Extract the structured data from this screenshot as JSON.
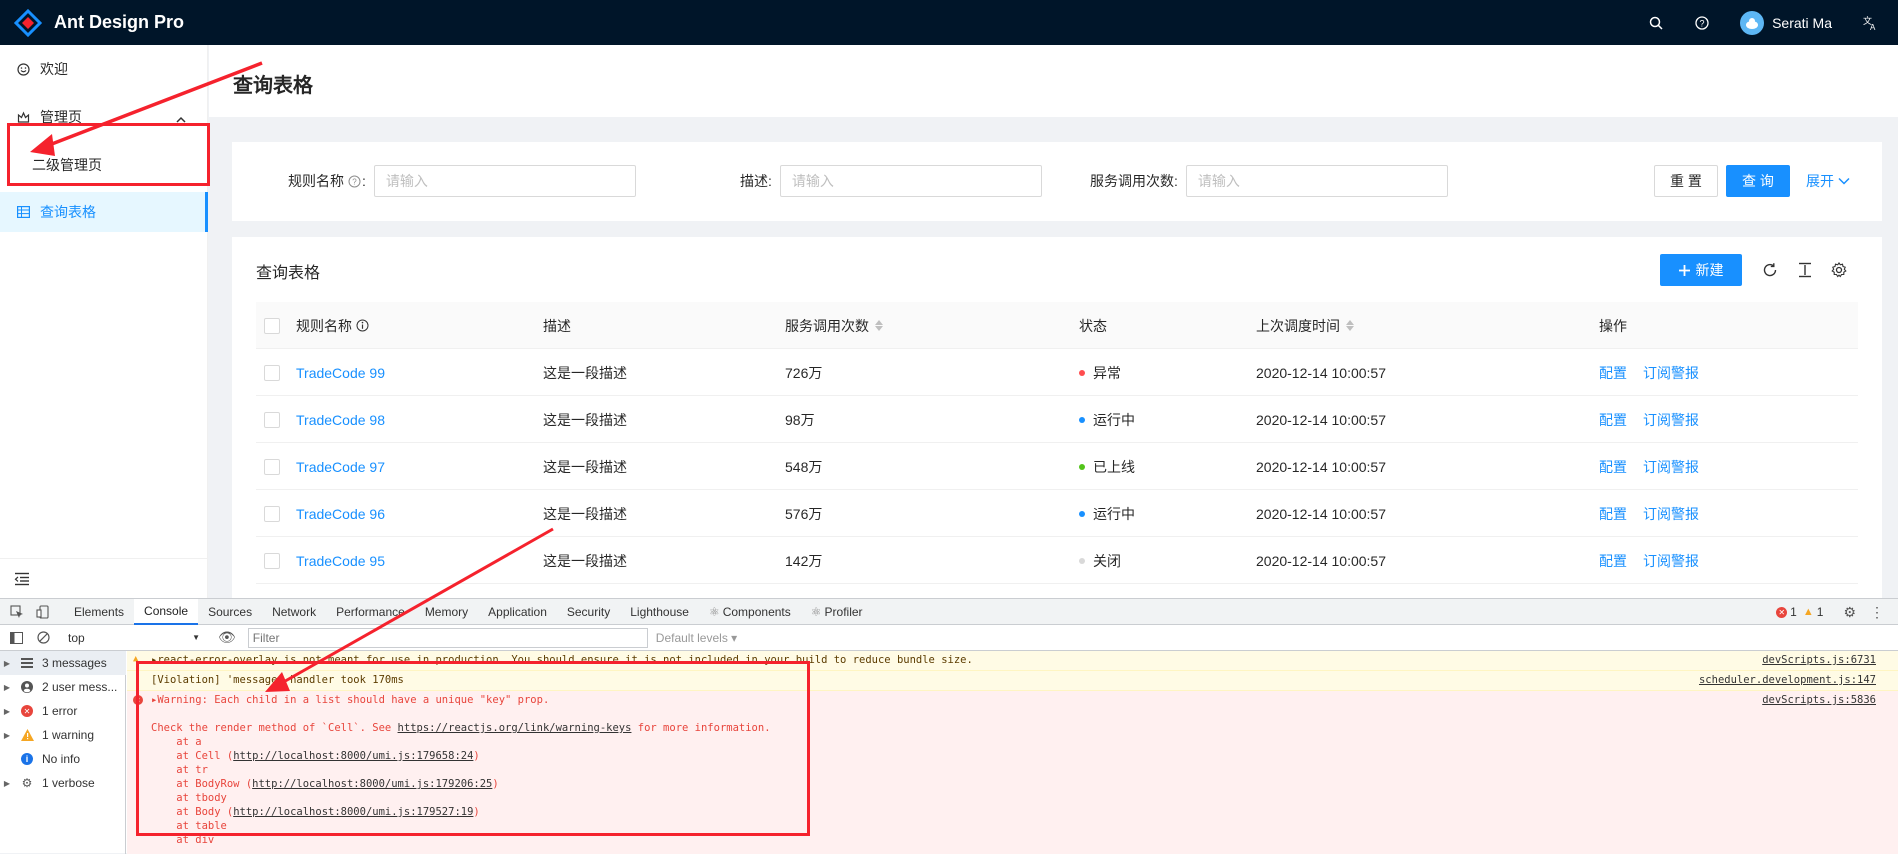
{
  "header": {
    "app_title": "Ant Design Pro",
    "user_name": "Serati Ma",
    "icons": [
      "search-icon",
      "question-icon",
      "user-avatar",
      "translate-icon"
    ]
  },
  "sidebar": {
    "items": [
      {
        "label": "欢迎",
        "icon": "smile-icon"
      },
      {
        "label": "管理页",
        "icon": "crown-icon"
      },
      {
        "label": "二级管理页"
      },
      {
        "label": "查询表格",
        "icon": "table-icon"
      }
    ]
  },
  "page": {
    "title": "查询表格"
  },
  "search": {
    "rule_name_label": "规则名称",
    "rule_name_placeholder": "请输入",
    "desc_label": "描述:",
    "desc_placeholder": "请输入",
    "calls_label": "服务调用次数:",
    "calls_placeholder": "请输入",
    "reset_label": "重 置",
    "query_label": "查 询",
    "expand_label": "展开"
  },
  "table": {
    "title": "查询表格",
    "new_label": "新建",
    "columns": [
      "规则名称",
      "描述",
      "服务调用次数",
      "状态",
      "上次调度时间",
      "操作"
    ],
    "rows": [
      {
        "name": "TradeCode 99",
        "desc": "这是一段描述",
        "calls": "726万",
        "status": "异常",
        "status_color": "#ff4d4f",
        "time": "2020-12-14 10:00:57",
        "op1": "配置",
        "op2": "订阅警报"
      },
      {
        "name": "TradeCode 98",
        "desc": "这是一段描述",
        "calls": "98万",
        "status": "运行中",
        "status_color": "#1890ff",
        "time": "2020-12-14 10:00:57",
        "op1": "配置",
        "op2": "订阅警报"
      },
      {
        "name": "TradeCode 97",
        "desc": "这是一段描述",
        "calls": "548万",
        "status": "已上线",
        "status_color": "#52c41a",
        "time": "2020-12-14 10:00:57",
        "op1": "配置",
        "op2": "订阅警报"
      },
      {
        "name": "TradeCode 96",
        "desc": "这是一段描述",
        "calls": "576万",
        "status": "运行中",
        "status_color": "#1890ff",
        "time": "2020-12-14 10:00:57",
        "op1": "配置",
        "op2": "订阅警报"
      },
      {
        "name": "TradeCode 95",
        "desc": "这是一段描述",
        "calls": "142万",
        "status": "关闭",
        "status_color": "#d9d9d9",
        "time": "2020-12-14 10:00:57",
        "op1": "配置",
        "op2": "订阅警报"
      }
    ]
  },
  "devtools": {
    "tabs": [
      "Elements",
      "Console",
      "Sources",
      "Network",
      "Performance",
      "Memory",
      "Application",
      "Security",
      "Lighthouse",
      "Components",
      "Profiler"
    ],
    "active_tab": "Console",
    "error_count": "1",
    "warning_count": "1",
    "context": "top",
    "filter_placeholder": "Filter",
    "levels_label": "Default levels",
    "side": [
      {
        "label": "3 messages",
        "icon": "list-icon"
      },
      {
        "label": "2 user mess...",
        "icon": "user-icon"
      },
      {
        "label": "1 error",
        "icon": "error-icon"
      },
      {
        "label": "1 warning",
        "icon": "warning-icon"
      },
      {
        "label": "No info",
        "icon": "info-icon"
      },
      {
        "label": "1 verbose",
        "icon": "verbose-icon"
      }
    ],
    "console": {
      "line1": "react-error-overlay is not meant for use in production. You should ensure it is not included in your build to reduce bundle size.",
      "line1_src": "devScripts.js:6731",
      "line2": "[Violation] 'message' handler took 170ms",
      "line2_src": "scheduler.development.js:147",
      "line3": "Warning: Each child in a list should have a unique \"key\" prop.",
      "line3_src": "devScripts.js:5836",
      "line4_pre": "Check the render method of `Cell`. See ",
      "line4_link": "https://reactjs.org/link/warning-keys",
      "line4_post": " for more information.",
      "stack": [
        {
          "pre": "    at a",
          "link": "",
          "post": ""
        },
        {
          "pre": "    at Cell (",
          "link": "http://localhost:8000/umi.js:179658:24",
          "post": ")"
        },
        {
          "pre": "    at tr",
          "link": "",
          "post": ""
        },
        {
          "pre": "    at BodyRow (",
          "link": "http://localhost:8000/umi.js:179206:25",
          "post": ")"
        },
        {
          "pre": "    at tbody",
          "link": "",
          "post": ""
        },
        {
          "pre": "    at Body (",
          "link": "http://localhost:8000/umi.js:179527:19",
          "post": ")"
        },
        {
          "pre": "    at table",
          "link": "",
          "post": ""
        },
        {
          "pre": "    at div",
          "link": "",
          "post": ""
        }
      ]
    }
  }
}
